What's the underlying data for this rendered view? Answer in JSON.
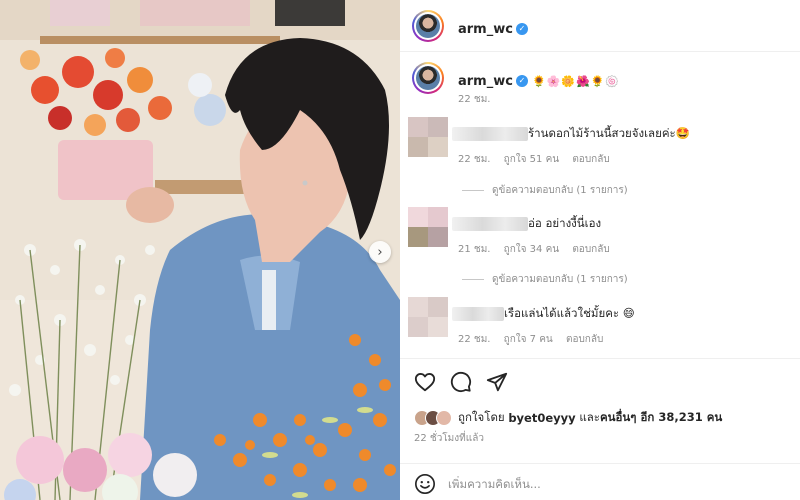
{
  "post": {
    "username": "arm_wc",
    "photo_alt": "",
    "caption_emojis": "🌻🌸🌼🌺🌻🍥",
    "caption_time": "22 ชม."
  },
  "comments": [
    {
      "text": "ร้านดอกไม้ร้านนี้สวยจังเลยค่ะ🤩",
      "time": "22 ชม.",
      "likes": "ถูกใจ 51 คน",
      "reply": "ตอบกลับ",
      "view_replies": "ดูข้อความตอบกลับ (1 รายการ)"
    },
    {
      "text": "อ่อ อย่างงี้นี่เอง",
      "time": "21 ชม.",
      "likes": "ถูกใจ 34 คน",
      "reply": "ตอบกลับ",
      "view_replies": "ดูข้อความตอบกลับ (1 รายการ)"
    },
    {
      "text": "เรือแล่นได้แล้วใช่มั้ยคะ 😄",
      "time": "22 ชม.",
      "likes": "ถูกใจ 7 คน",
      "reply": "ตอบกลับ"
    }
  ],
  "likes_line": {
    "prefix": "ถูกใจโดย",
    "user": "byet0eyyy",
    "middle": "และ",
    "others": "คนอื่นๆ อีก 38,231 คน"
  },
  "posted_ago": "22 ชั่วโมงที่แล้ว",
  "add_comment": {
    "placeholder": "เพิ่มความคิดเห็น..."
  },
  "icons": {
    "like": "heart-icon",
    "comment": "comment-icon",
    "share": "share-icon",
    "next": "chevron-right-icon",
    "emoji": "smile-icon",
    "verified": "verified-badge-icon"
  },
  "colors": {
    "verified": "#3897f0",
    "muted_text": "#8e8e8e",
    "primary_text": "#262626"
  }
}
